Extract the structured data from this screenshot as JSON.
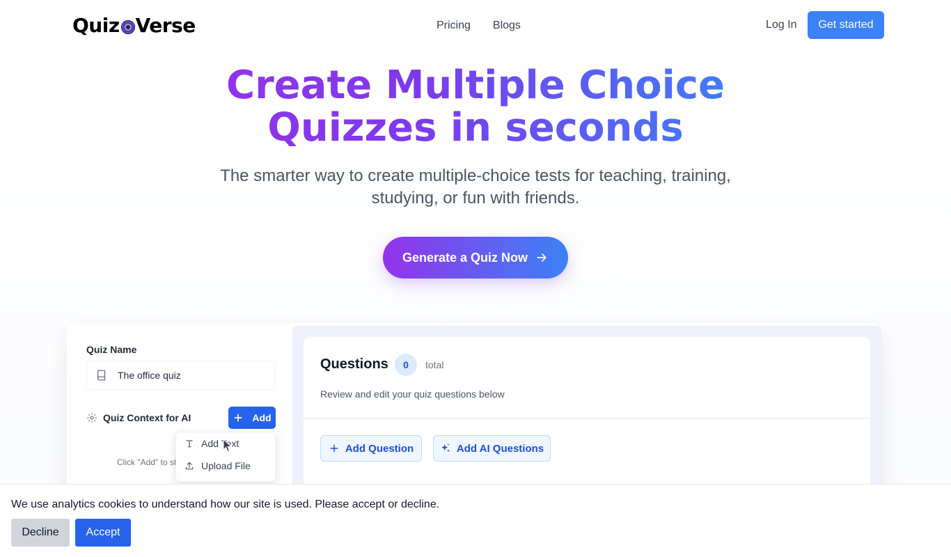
{
  "header": {
    "logo_left": "Quiz",
    "logo_right": "Verse",
    "nav": [
      {
        "label": "Pricing"
      },
      {
        "label": "Blogs"
      }
    ],
    "login": "Log In",
    "get_started": "Get started"
  },
  "hero": {
    "title_line1": "Create Multiple Choice",
    "title_line2": "Quizzes in seconds",
    "subtitle_line1": "The smarter way to create multiple-choice tests for teaching, training,",
    "subtitle_line2": "studying, or fun with friends.",
    "cta": "Generate a Quiz Now"
  },
  "editor": {
    "quiz_name_label": "Quiz Name",
    "quiz_name_value": "The office quiz",
    "context_label": "Quiz Context for AI",
    "add_label": "Add",
    "hint": "Click \"Add\" to st",
    "dropdown": [
      {
        "label": "Add Text",
        "icon": "text-icon"
      },
      {
        "label": "Upload File",
        "icon": "upload-icon"
      }
    ],
    "questions_title": "Questions",
    "questions_count": "0",
    "questions_total": "total",
    "questions_desc": "Review and edit your quiz questions below",
    "add_question": "Add Question",
    "add_ai_questions": "Add AI Questions"
  },
  "cookie": {
    "text": "We use analytics cookies to understand how our site is used. Please accept or decline.",
    "decline": "Decline",
    "accept": "Accept"
  },
  "colors": {
    "primary": "#2563eb",
    "accent_blue": "#3b82f6",
    "accent_purple": "#9333ea",
    "panel_bg": "#eef0fb"
  }
}
